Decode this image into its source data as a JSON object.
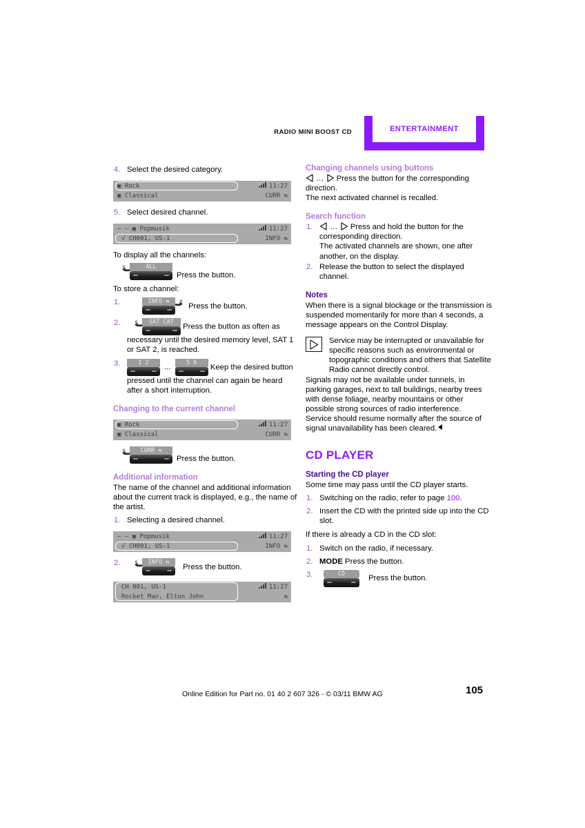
{
  "header": {
    "manual_label": "RADIO MINI BOOST CD",
    "tab_label": "ENTERTAINMENT"
  },
  "colors": {
    "accent_purple": "#8c1aff",
    "heading_pink": "#b07cd8",
    "heading_violet": "#4b0a96",
    "step_number": "#9b4dd8",
    "display_bg": "#aaaaaa",
    "key_dark": "#1d1d1d"
  },
  "left_column": {
    "step_4": {
      "num": "4.",
      "text": "Select the desired category."
    },
    "display_1": {
      "row1": "▣ Rock",
      "row2": "▣ Classical",
      "time": "11:27",
      "corner": "CURR  ⇆",
      "selected_row": 1
    },
    "step_5": {
      "num": "5.",
      "text": "Select desired channel."
    },
    "display_2": {
      "row1": "– – ▣ Popmusik",
      "row2": "√ CH001, US-1",
      "time": "11:27",
      "corner": "INFO  ⇆",
      "selected_row": 2
    },
    "display_all_lead": "To display all the channels:",
    "btn_all": {
      "cap": "ALL",
      "text": "Press the button."
    },
    "store_lead": "To store a channel:",
    "store_step_1": {
      "num": "1.",
      "cap": "INFO  ⇆",
      "text": "Press the button."
    },
    "store_step_2": {
      "num": "2.",
      "cap": "SAT CAT",
      "text": "Press the button as often as necessary until the desired memory level, SAT 1 or SAT 2, is reached."
    },
    "store_step_3": {
      "num": "3.",
      "cap_a": "1      2",
      "cap_b": "5      6",
      "ellipsis": "...",
      "text": "Keep the desired button pressed until the channel can again be heard after a short interruption."
    },
    "heading_current_channel": "Changing to the current channel",
    "display_3": {
      "row1": "▣ Rock",
      "row2": "▣ Classical",
      "time": "11:27",
      "corner": "CURR  ⇆",
      "selected_row": 1
    },
    "btn_curr": {
      "cap": "CURR  ⇆",
      "text": "Press the button."
    },
    "heading_additional_info": "Additional information",
    "additional_info_text": "The name of the channel and additional information about the current track is displayed, e.g., the name of the artist.",
    "ai_step_1": {
      "num": "1.",
      "text": "Selecting a desired channel."
    },
    "display_4": {
      "row1": "– – ▣ Popmusik",
      "row2": "√ CH001, US-1",
      "time": "11:27",
      "corner": "INFO  ⇆",
      "selected_row": 2
    },
    "ai_step_2": {
      "num": "2.",
      "cap": "INFO  ⇆",
      "text": "Press the button."
    },
    "display_5": {
      "row1": "CH 001, US-1",
      "row2": "Rocket Man, Elton John",
      "time": "11:27",
      "corner": "⇆",
      "selected_row": 0
    }
  },
  "right_column": {
    "heading_changing_channels": "Changing channels using buttons",
    "changing_channels_text": "Press the button for the corresponding direction.",
    "changing_channels_text2": "The next activated channel is recalled.",
    "heading_search": "Search function",
    "search_step_1": {
      "num": "1.",
      "text": "Press and hold the button for the corresponding direction.",
      "text2": "The activated channels are shown, one after another, on the display."
    },
    "search_step_2": {
      "num": "2.",
      "text": "Release the button to select the displayed channel."
    },
    "heading_notes": "Notes",
    "notes_p1": "When there is a signal blockage or the transmission is suspended momentarily for more than 4 seconds, a message appears on the Control Display.",
    "notes_boxed": "Service may be interrupted or unavailable for specific reasons such as environmental or topographic conditions and others that Satellite Radio cannot directly control.",
    "notes_p2": "Signals may not be available under tunnels, in parking garages, next to tall buildings, nearby trees with dense foliage, nearby mountains or other possible strong sources of radio interference.",
    "notes_p3": "Service should resume normally after the source of signal unavailability has been cleared.",
    "heading_cd_player": "CD PLAYER",
    "heading_starting": "Starting the CD player",
    "starting_intro": "Some time may pass until the CD player starts.",
    "cd_step_1": {
      "num": "1.",
      "text_before": "Switching on the radio, refer to page ",
      "page_ref": "100",
      "text_after": "."
    },
    "cd_step_2": {
      "num": "2.",
      "text": "Insert the CD with the printed side up into the CD slot."
    },
    "already_lead": "If there is already a CD in the CD slot:",
    "alr_step_1": {
      "num": "1.",
      "text": "Switch on the radio, if necessary."
    },
    "alr_step_2": {
      "num": "2.",
      "bold": "MODE",
      "text": " Press the button."
    },
    "alr_step_3": {
      "num": "3.",
      "cap": "CD",
      "text": "Press the button."
    }
  },
  "footer": {
    "text": "Online Edition for Part no. 01 40 2 607 326 - © 03/11 BMW AG",
    "page_number": "105"
  },
  "icons": {
    "arrow_left": "◁",
    "arrow_right": "▷",
    "ellipsis": "…"
  }
}
